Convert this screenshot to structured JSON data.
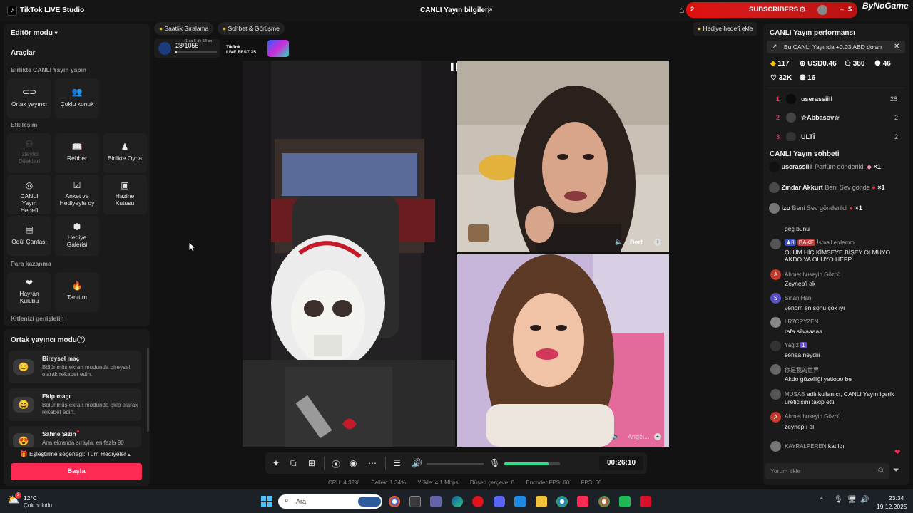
{
  "titlebar": {
    "app_name": "TikTok LIVE Studio",
    "stream_info": "CANLI Yayın bilgileri",
    "subscribers_label": "SUBSCRIBERS",
    "subscribers_left": "2",
    "subscribers_right": "5",
    "brand": "ByNoGame"
  },
  "left": {
    "editor_mode": "Editör modu",
    "tools_title": "Araçlar",
    "sections": {
      "together": "Birlikte CANLI Yayın yapın",
      "interaction": "Etkileşim",
      "earn": "Para kazanma",
      "expand": "Kitlenizi genişletin"
    },
    "tools": {
      "cohost": "Ortak yayıncı",
      "multi_guest": "Çoklu konuk",
      "viewer_requests": "İzleyici Dilekleri",
      "guide": "Rehber",
      "play_together": "Birlikte Oyna",
      "live_goal": "CANLI Yayın Hedefi",
      "poll": "Anket ve Hediyeyle oy",
      "treasure": "Hazine Kutusu",
      "reward_bag": "Ödül Çantası",
      "gift_gallery": "Hediye Galerisi",
      "fan_club": "Hayran Kulübü",
      "promotion": "Tanıtım"
    },
    "cohost_mode": {
      "title": "Ortak yayıncı modu",
      "cards": [
        {
          "title": "Bireysel maç",
          "desc": "Bölünmüş ekran modunda bireysel olarak rekabet edin."
        },
        {
          "title": "Ekip maçı",
          "desc": "Bölünmüş ekran modunda ekip olarak rekabet edin."
        },
        {
          "title": "Sahne Sizin",
          "desc": "Ana ekranda sırayla, en fazla 90"
        }
      ],
      "match_option": "Eşleştirme seçeneği: Tüm Hediyeler",
      "start": "Başla"
    }
  },
  "top": {
    "hourly_rank": "Saatlik Sıralama",
    "chat_meet": "Sohbet & Görüşme",
    "goal": "Hediye hedefi ekle",
    "rank_value": "28/1055",
    "rank_progress": 0.03,
    "rank_timer": "1 sa 5 dk 54 sn",
    "fest_brand": "TikTok",
    "fest_name": "LIVE FEST 25"
  },
  "video": {
    "guest1": "Berf",
    "guest2": "Angel..."
  },
  "controls": {
    "timer": "00:26:10",
    "mic_level": 0.8
  },
  "stats": {
    "cpu": "CPU: 4.32%",
    "memory": "Bellek: 1.34%",
    "upload": "Yükle: 4.1 Mbps",
    "dropped": "Düşen çerçeve: 0",
    "encoder": "Encoder FPS: 60",
    "fps": "FPS: 60"
  },
  "right": {
    "perf_title": "CANLI Yayın performansı",
    "notice": "Bu CANLI Yayında +0.03 ABD doları",
    "stats": {
      "diamonds": "117",
      "usd": "USD0.46",
      "viewers": "360",
      "new_followers": "46",
      "likes": "32K",
      "gifters": "16"
    },
    "ranking": [
      {
        "rank": "1",
        "name": "userassiill",
        "score": "28"
      },
      {
        "rank": "2",
        "name": "☆Abbasov☆",
        "score": "2"
      },
      {
        "rank": "3",
        "name": "ULTİ",
        "score": "2"
      }
    ],
    "chat_title": "CANLI Yayın sohbeti",
    "gifts": [
      {
        "user": "userassiill",
        "text": "Parfüm gönderildi",
        "count": "×1"
      },
      {
        "user": "Zındar Akkurt",
        "text": "Beni Sev gönde",
        "count": "×1"
      },
      {
        "user": "izo",
        "text": "Beni Sev gönderildi",
        "count": "×1"
      }
    ],
    "chat": [
      {
        "name": "",
        "msg": "geç bunu"
      },
      {
        "name": "İsmail erdemm",
        "badge": "BAKE",
        "msg": "OLUM HİÇ KİMSEYE BİŞEY OLMUYO AKDO YA OLUYO HEPP"
      },
      {
        "name": "Ahmet huseyin Gözcü",
        "msg": "Zeynep'i ak"
      },
      {
        "name": "Sinan Han",
        "msg": "venom en sonu çok iyi"
      },
      {
        "name": "LR7CRYZEN",
        "msg": "rafa silvaaaaa"
      },
      {
        "name": "Yağız",
        "msg": "senaa neydiii"
      },
      {
        "name": "你是我的世界",
        "msg": "Akdo güzelliği yetiooo be"
      },
      {
        "name": "MUSAB",
        "msg": "adlı kullanıcı, CANLI Yayın içerik üreticisini takip etti"
      },
      {
        "name": "Ahmet huseyin Gözcü",
        "msg": "zeynep ı al"
      },
      {
        "name": "KAYRALPEREN",
        "msg": "katıldı"
      }
    ],
    "comment_placeholder": "Yorum ekle"
  },
  "taskbar": {
    "temp": "12°C",
    "weather": "Çok bulutlu",
    "search_placeholder": "Ara",
    "time": "23:34",
    "date": "19.12.2025",
    "notif_count": "2"
  }
}
